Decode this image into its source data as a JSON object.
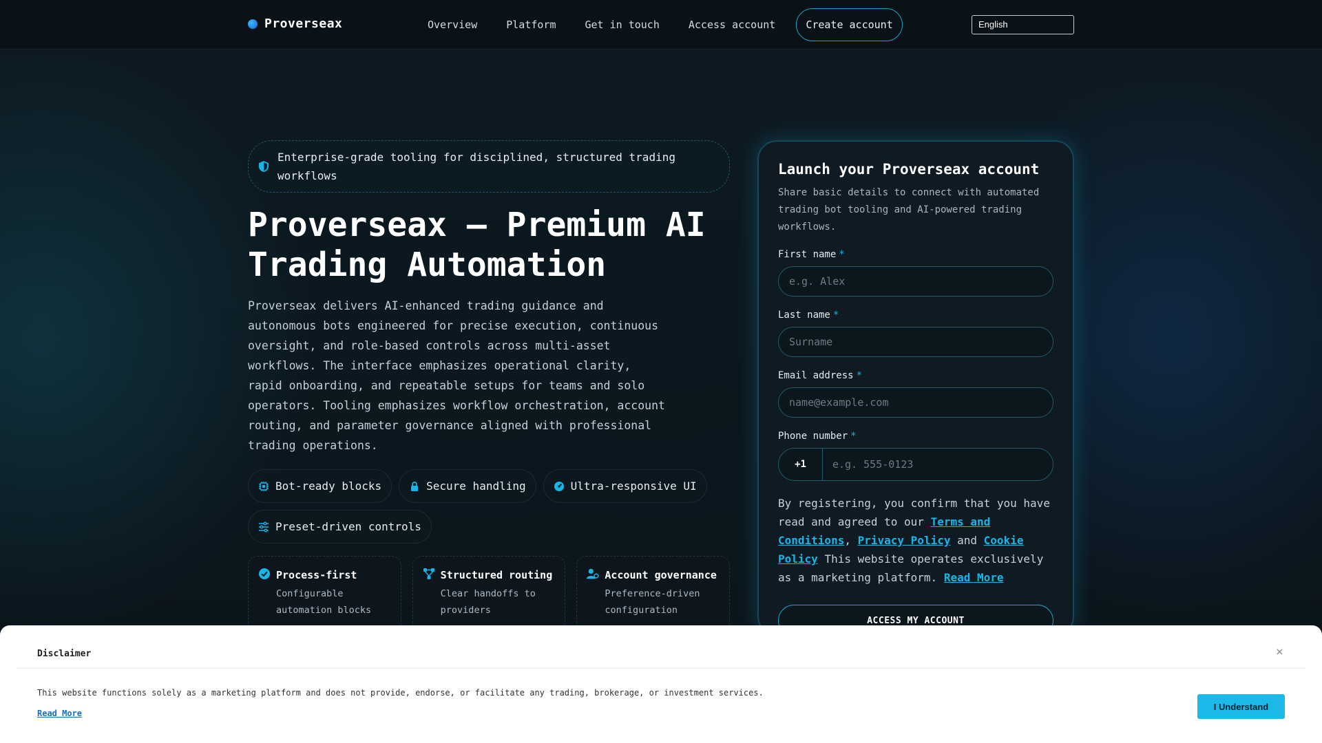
{
  "header": {
    "brand": "Proverseax",
    "nav": [
      "Overview",
      "Platform",
      "Get in touch",
      "Access account"
    ],
    "create_account": "Create account",
    "language": "English"
  },
  "hero": {
    "tagline": "Enterprise-grade tooling for disciplined, structured trading workflows",
    "title_line1": "Proverseax — Premium AI",
    "title_line2": "Trading Automation",
    "description": "Proverseax delivers AI-enhanced trading guidance and autonomous bots engineered for precise execution, continuous oversight, and role-based controls across multi-asset workflows. The interface emphasizes operational clarity, rapid onboarding, and repeatable setups for teams and solo operators. Tooling emphasizes workflow orchestration, account routing, and parameter governance aligned with professional trading operations.",
    "chips": [
      "Bot-ready blocks",
      "Secure handling",
      "Ultra-responsive UI",
      "Preset-driven controls"
    ],
    "cards": [
      {
        "title": "Process-first",
        "desc": "Configurable automation blocks"
      },
      {
        "title": "Structured routing",
        "desc": "Clear handoffs to providers"
      },
      {
        "title": "Account governance",
        "desc": "Preference-driven configuration"
      }
    ]
  },
  "form": {
    "title": "Launch your Proverseax account",
    "subtitle": "Share basic details to connect with automated trading bot tooling and AI-powered trading workflows.",
    "first_name_label": "First name",
    "first_name_placeholder": "e.g. Alex",
    "last_name_label": "Last name",
    "last_name_placeholder": "Surname",
    "email_label": "Email address",
    "email_placeholder": "name@example.com",
    "phone_label": "Phone number",
    "phone_code": "+1",
    "phone_placeholder": "e.g. 555-0123",
    "required_mark": "*",
    "consent_prefix": "By registering, you confirm that you have read and agreed to our",
    "terms": "Terms and Conditions",
    "sep1": ",",
    "privacy": "Privacy Policy",
    "and": "and",
    "cookie": "Cookie Policy",
    "consent_suffix": "This website operates exclusively as a marketing platform.",
    "read_more": "Read More",
    "submit": "ACCESS MY ACCOUNT"
  },
  "disclaimer": {
    "title": "Disclaimer",
    "close": "×",
    "text": "This website functions solely as a marketing platform and does not provide, endorse, or facilitate any trading, brokerage, or investment services.",
    "read_more": "Read More",
    "button": "I Understand"
  },
  "colors": {
    "accent": "#16b6e8",
    "background": "#0b1218",
    "button": "#1ab9e8"
  }
}
